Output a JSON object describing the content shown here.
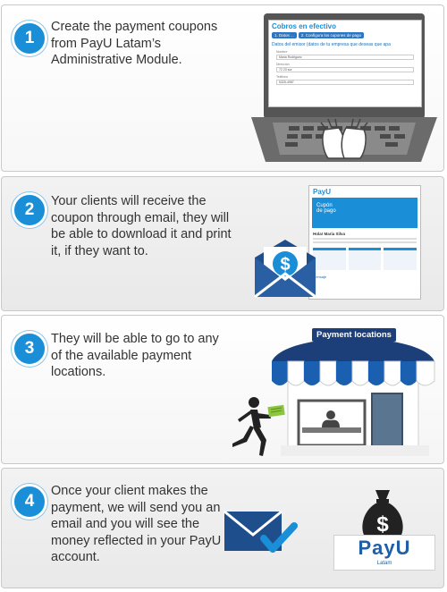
{
  "steps": [
    {
      "number": "1",
      "text": "Create the payment coupons from PayU Latam’s Administrative Module."
    },
    {
      "number": "2",
      "text": "Your clients will receive the coupon through email, they will be able to download it and print it, if they want to."
    },
    {
      "number": "3",
      "text": "They will be able to go to any of the available payment locations."
    },
    {
      "number": "4",
      "text": "Once your client makes the payment, we will send you an email and you will see the money reflected in your PayU account."
    }
  ],
  "laptop_screen": {
    "title": "Cobros en efectivo",
    "step_tabs": [
      "1. Datos ...",
      "2. Configura los cupones de pago"
    ],
    "section_label": "Datos del emisor (datos de tu empresa que deseas que apa",
    "fields": [
      {
        "label": "Nombre",
        "value": "Maria Rodriguez"
      },
      {
        "label": "Dirección",
        "value": "72 23 sur"
      },
      {
        "label": "Teléfono",
        "value": "5325-4987"
      }
    ]
  },
  "coupon_email": {
    "brand": "PayU",
    "banner_line1": "Cupón",
    "banner_line2": "de pago",
    "greeting": "Hola! Maria Silva",
    "message_label": "Mensaje"
  },
  "store": {
    "sign": "Payment locations"
  },
  "payu_logo": {
    "wordmark": "PayU",
    "sub": "Latam"
  },
  "colors": {
    "accent": "#1a8fd8",
    "navy": "#1c3f7a",
    "green": "#8cc63f"
  },
  "icons": [
    "laptop-icon",
    "envelope-dollar-icon",
    "store-icon",
    "running-man-icon",
    "mail-check-icon",
    "money-bag-icon"
  ]
}
